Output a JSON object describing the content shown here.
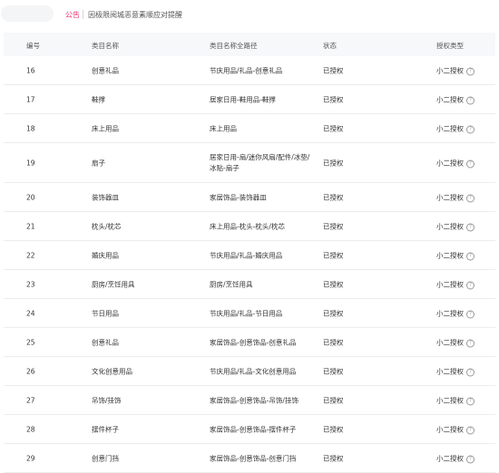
{
  "notice": {
    "label": "公告",
    "text": "因极限阅城恶意素顺应对提醒"
  },
  "columns": {
    "no": "编号",
    "name": "类目名称",
    "path": "类目名称全路径",
    "status": "状态",
    "type": "授权类型"
  },
  "rows": [
    {
      "no": "16",
      "name": "创意礼品",
      "path": "节庆用品/礼品-创意礼品",
      "status": "已授权",
      "type": "小二授权"
    },
    {
      "no": "17",
      "name": "鞋撑",
      "path": "居家日用-鞋用品-鞋撑",
      "status": "已授权",
      "type": "小二授权"
    },
    {
      "no": "18",
      "name": "床上用品",
      "path": "床上用品",
      "status": "已授权",
      "type": "小二授权"
    },
    {
      "no": "19",
      "name": "扇子",
      "path": "居家日用-扇/迷你风扇/配件/冰垫/冰贴-扇子",
      "status": "已授权",
      "type": "小二授权"
    },
    {
      "no": "20",
      "name": "装饰器皿",
      "path": "家居饰品-装饰器皿",
      "status": "已授权",
      "type": "小二授权"
    },
    {
      "no": "21",
      "name": "枕头/枕芯",
      "path": "床上用品-枕头-枕头/枕芯",
      "status": "已授权",
      "type": "小二授权"
    },
    {
      "no": "22",
      "name": "婚庆用品",
      "path": "节庆用品/礼品-婚庆用品",
      "status": "已授权",
      "type": "小二授权"
    },
    {
      "no": "23",
      "name": "厨房/烹饪用具",
      "path": "厨房/烹饪用具",
      "status": "已授权",
      "type": "小二授权"
    },
    {
      "no": "24",
      "name": "节日用品",
      "path": "节庆用品/礼品-节日用品",
      "status": "已授权",
      "type": "小二授权"
    },
    {
      "no": "25",
      "name": "创意礼品",
      "path": "家居饰品-创意饰品-创意礼品",
      "status": "已授权",
      "type": "小二授权"
    },
    {
      "no": "26",
      "name": "文化创意用品",
      "path": "节庆用品/礼品-文化创意用品",
      "status": "已授权",
      "type": "小二授权"
    },
    {
      "no": "27",
      "name": "吊饰/挂饰",
      "path": "家居饰品-创意饰品-吊饰/挂饰",
      "status": "已授权",
      "type": "小二授权"
    },
    {
      "no": "28",
      "name": "摆件杯子",
      "path": "家居饰品-创意饰品-摆件杯子",
      "status": "已授权",
      "type": "小二授权"
    },
    {
      "no": "29",
      "name": "创意门挡",
      "path": "家居饰品-创意饰品-创意门挡",
      "status": "已授权",
      "type": "小二授权"
    }
  ]
}
